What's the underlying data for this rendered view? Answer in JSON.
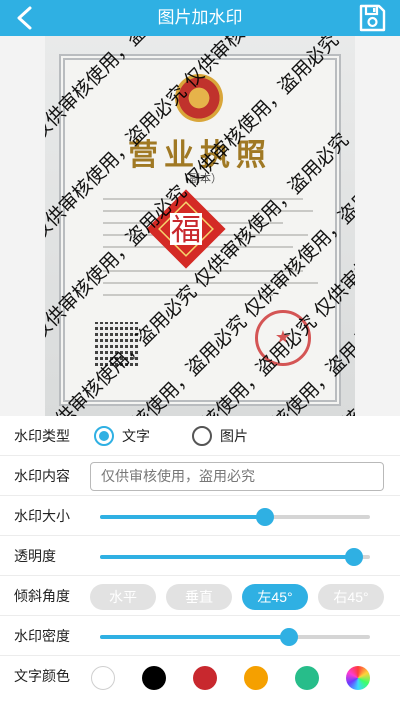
{
  "header": {
    "title": "图片加水印",
    "back_icon": "chevron-left-icon",
    "save_icon": "save-icon"
  },
  "preview": {
    "certificate": {
      "title": "营业执照",
      "subtitle": "（副本）"
    },
    "sticker_char": "福",
    "watermark_text": "仅供审核使用，盗用必究"
  },
  "settings": {
    "type": {
      "label": "水印类型",
      "options": [
        "文字",
        "图片"
      ],
      "selected": "文字"
    },
    "content": {
      "label": "水印内容",
      "value": "仅供审核使用，盗用必究"
    },
    "size": {
      "label": "水印大小",
      "value": 0.61
    },
    "opacity": {
      "label": "透明度",
      "value": 0.94
    },
    "angle": {
      "label": "倾斜角度",
      "options": [
        "水平",
        "垂直",
        "左45°",
        "右45°"
      ],
      "selected": "左45°"
    },
    "density": {
      "label": "水印密度",
      "value": 0.7
    },
    "color": {
      "label": "文字颜色",
      "swatches": [
        "#ffffff",
        "#000000",
        "#c8282e",
        "#f5a000",
        "#27bd8a",
        "rainbow"
      ],
      "selected_index": 1
    }
  },
  "colors": {
    "accent": "#2fb0e3",
    "pill_inactive": "#e2e2e2"
  }
}
